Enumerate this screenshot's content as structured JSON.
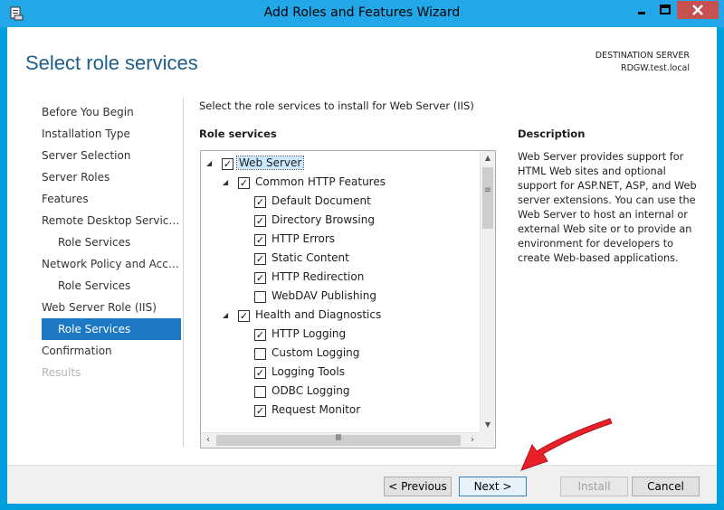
{
  "window": {
    "title": "Add Roles and Features Wizard"
  },
  "header": {
    "title": "Select role services",
    "destination_label": "DESTINATION SERVER",
    "destination_server": "RDGW.test.local"
  },
  "nav": {
    "items": [
      {
        "label": "Before You Begin",
        "state": "normal",
        "sub": false
      },
      {
        "label": "Installation Type",
        "state": "normal",
        "sub": false
      },
      {
        "label": "Server Selection",
        "state": "normal",
        "sub": false
      },
      {
        "label": "Server Roles",
        "state": "normal",
        "sub": false
      },
      {
        "label": "Features",
        "state": "normal",
        "sub": false
      },
      {
        "label": "Remote Desktop Services",
        "state": "normal",
        "sub": false
      },
      {
        "label": "Role Services",
        "state": "normal",
        "sub": true
      },
      {
        "label": "Network Policy and Acces...",
        "state": "normal",
        "sub": false
      },
      {
        "label": "Role Services",
        "state": "normal",
        "sub": true
      },
      {
        "label": "Web Server Role (IIS)",
        "state": "normal",
        "sub": false
      },
      {
        "label": "Role Services",
        "state": "active",
        "sub": true
      },
      {
        "label": "Confirmation",
        "state": "normal",
        "sub": false
      },
      {
        "label": "Results",
        "state": "disabled",
        "sub": false
      }
    ]
  },
  "main": {
    "instruction": "Select the role services to install for Web Server (IIS)",
    "role_services_heading": "Role services",
    "tree": [
      {
        "label": "Web Server",
        "level": 0,
        "checked": true,
        "expander": "◢",
        "selected": true
      },
      {
        "label": "Common HTTP Features",
        "level": 1,
        "checked": true,
        "expander": "◢",
        "selected": false
      },
      {
        "label": "Default Document",
        "level": 2,
        "checked": true,
        "expander": "",
        "selected": false
      },
      {
        "label": "Directory Browsing",
        "level": 2,
        "checked": true,
        "expander": "",
        "selected": false
      },
      {
        "label": "HTTP Errors",
        "level": 2,
        "checked": true,
        "expander": "",
        "selected": false
      },
      {
        "label": "Static Content",
        "level": 2,
        "checked": true,
        "expander": "",
        "selected": false
      },
      {
        "label": "HTTP Redirection",
        "level": 2,
        "checked": true,
        "expander": "",
        "selected": false
      },
      {
        "label": "WebDAV Publishing",
        "level": 2,
        "checked": false,
        "expander": "",
        "selected": false
      },
      {
        "label": "Health and Diagnostics",
        "level": 1,
        "checked": true,
        "expander": "◢",
        "selected": false
      },
      {
        "label": "HTTP Logging",
        "level": 2,
        "checked": true,
        "expander": "",
        "selected": false
      },
      {
        "label": "Custom Logging",
        "level": 2,
        "checked": false,
        "expander": "",
        "selected": false
      },
      {
        "label": "Logging Tools",
        "level": 2,
        "checked": true,
        "expander": "",
        "selected": false
      },
      {
        "label": "ODBC Logging",
        "level": 2,
        "checked": false,
        "expander": "",
        "selected": false
      },
      {
        "label": "Request Monitor",
        "level": 2,
        "checked": true,
        "expander": "",
        "selected": false
      }
    ],
    "description_heading": "Description",
    "description": "Web Server provides support for HTML Web sites and optional support for ASP.NET, ASP, and Web server extensions. You can use the Web Server to host an internal or external Web site or to provide an environment for developers to create Web-based applications."
  },
  "footer": {
    "previous_label": "< Previous",
    "next_label": "Next >",
    "install_label": "Install",
    "cancel_label": "Cancel"
  },
  "colors": {
    "accent": "#1d79c4",
    "title_blue": "#1c5f8c",
    "frame": "#22a7e8",
    "annotation_arrow": "#e8202a"
  }
}
